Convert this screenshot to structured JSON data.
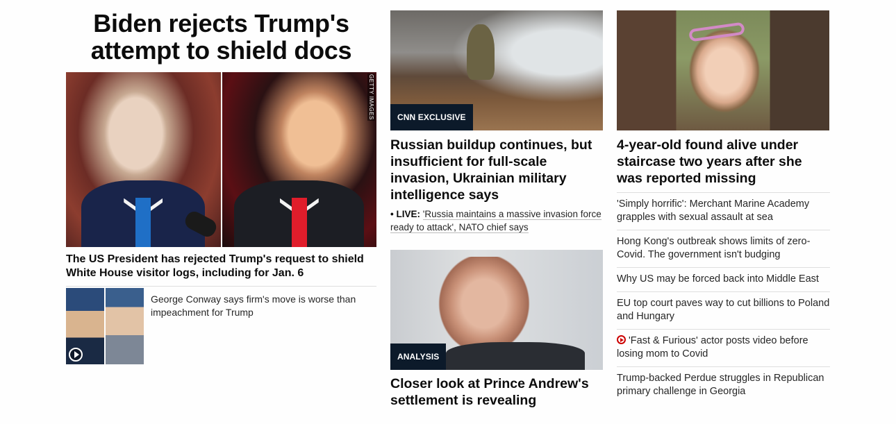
{
  "lead": {
    "headline": "Biden rejects Trump's attempt to shield docs",
    "image_credit": "GETTY IMAGES",
    "subheadline": "The US President has rejected Trump's request to shield White House visitor logs, including for Jan. 6",
    "related": {
      "text": "George Conway says firm's move is worse than impeachment for Trump",
      "icon": "play-icon"
    }
  },
  "middle": {
    "card1": {
      "tag": "CNN EXCLUSIVE",
      "headline": "Russian buildup continues, but insufficient for full-scale invasion, Ukrainian military intelligence says",
      "live_bullet": "•",
      "live_label": "LIVE:",
      "live_text": "'Russia maintains a massive invasion force ready to attack', NATO chief says"
    },
    "card2": {
      "tag": "ANALYSIS",
      "headline": "Closer look at Prince Andrew's settlement is revealing"
    }
  },
  "right": {
    "card": {
      "headline": "4-year-old found alive under staircase two years after she was reported missing"
    },
    "items": [
      {
        "text": "'Simply horrific': Merchant Marine Academy grapples with sexual assault at sea"
      },
      {
        "text": "Hong Kong's outbreak shows limits of zero-Covid. The government isn't budging"
      },
      {
        "text": "Why US may be forced back into Middle East"
      },
      {
        "text": "EU top court paves way to cut billions to Poland and Hungary"
      },
      {
        "text": "'Fast & Furious' actor posts video before losing mom to Covid",
        "icon": "video-play-icon"
      },
      {
        "text": "Trump-backed Perdue struggles in Republican primary challenge in Georgia"
      }
    ]
  },
  "colors": {
    "tag_background": "#0c1a2a",
    "video_icon": "#cc0000",
    "divider": "#dedede"
  }
}
